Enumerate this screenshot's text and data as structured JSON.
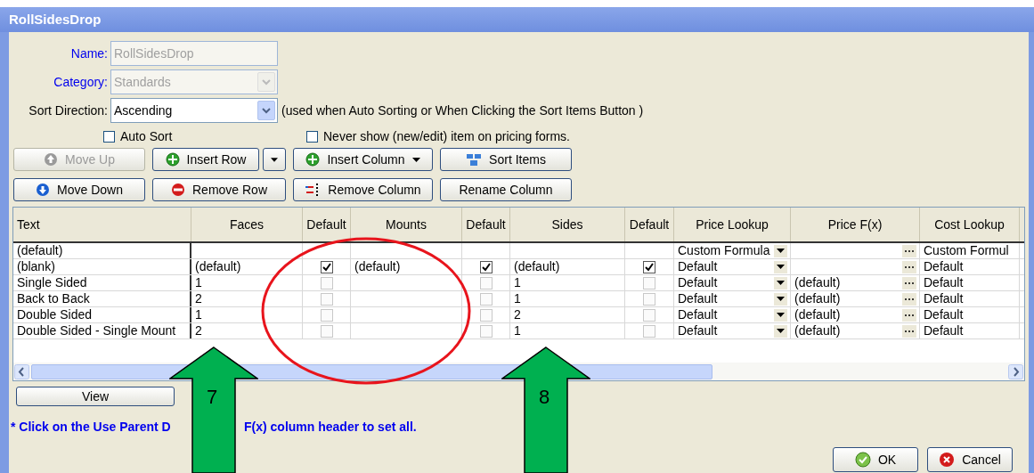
{
  "window": {
    "title": "RollSidesDrop"
  },
  "form": {
    "name": {
      "label": "Name:",
      "value": "RollSidesDrop",
      "disabled": true
    },
    "category": {
      "label": "Category:",
      "value": "Standards",
      "disabled": true
    },
    "sort_direction": {
      "label": "Sort Direction:",
      "value": "Ascending",
      "disabled": false,
      "hint": "(used when Auto Sorting or When Clicking the Sort Items Button )"
    },
    "checkboxes": [
      {
        "label": "Auto Sort",
        "checked": false
      },
      {
        "label": "Never show (new/edit) item on pricing forms.",
        "checked": false
      }
    ]
  },
  "toolbar": [
    [
      {
        "label": "Move Up",
        "disabled": true
      },
      {
        "label": "Insert Row",
        "split": true,
        "disabled": false
      },
      {
        "label": "Insert Column",
        "menu": true,
        "disabled": false
      },
      {
        "label": "Sort Items",
        "disabled": false
      }
    ],
    [
      {
        "label": "Move Down",
        "disabled": false
      },
      {
        "label": "Remove Row",
        "disabled": false
      },
      {
        "label": "Remove Column",
        "disabled": false
      },
      {
        "label": "Rename Column",
        "disabled": false
      }
    ]
  ],
  "table": {
    "columns": [
      {
        "label": "Text",
        "kind": "text"
      },
      {
        "label": "Faces",
        "kind": "text"
      },
      {
        "label": "Default",
        "kind": "check"
      },
      {
        "label": "Mounts",
        "kind": "text"
      },
      {
        "label": "Default",
        "kind": "check"
      },
      {
        "label": "Sides",
        "kind": "text"
      },
      {
        "label": "Default",
        "kind": "check"
      },
      {
        "label": "Price Lookup",
        "kind": "dropdown"
      },
      {
        "label": "Price F(x)",
        "kind": "formula"
      },
      {
        "label": "Cost Lookup",
        "kind": "text"
      }
    ],
    "rows": [
      [
        {
          "text": "(default)"
        },
        {},
        {},
        {},
        {},
        {},
        {},
        {
          "text": "Custom Formula"
        },
        {},
        {
          "text": "Custom Formul"
        }
      ],
      [
        {
          "text": "(blank)"
        },
        {
          "text": "(default)"
        },
        {
          "checked": true
        },
        {
          "text": "(default)"
        },
        {
          "checked": true
        },
        {
          "text": "(default)"
        },
        {
          "checked": true
        },
        {
          "text": "Default"
        },
        {},
        {
          "text": "Default"
        }
      ],
      [
        {
          "text": "Single Sided"
        },
        {
          "text": "1"
        },
        {
          "checked": false
        },
        {},
        {
          "checked": false
        },
        {
          "text": "1"
        },
        {
          "checked": false
        },
        {
          "text": "Default"
        },
        {
          "text": "(default)"
        },
        {
          "text": "Default"
        }
      ],
      [
        {
          "text": "Back to Back"
        },
        {
          "text": "2"
        },
        {
          "checked": false
        },
        {},
        {
          "checked": false
        },
        {
          "text": "1"
        },
        {
          "checked": false
        },
        {
          "text": "Default"
        },
        {
          "text": "(default)"
        },
        {
          "text": "Default"
        }
      ],
      [
        {
          "text": "Double Sided"
        },
        {
          "text": "1"
        },
        {
          "checked": false
        },
        {},
        {
          "checked": false
        },
        {
          "text": "2"
        },
        {
          "checked": false
        },
        {
          "text": "Default"
        },
        {
          "text": "(default)"
        },
        {
          "text": "Default"
        }
      ],
      [
        {
          "text": "Double Sided - Single Mount"
        },
        {
          "text": "2"
        },
        {
          "checked": false
        },
        {},
        {
          "checked": false
        },
        {
          "text": "1"
        },
        {
          "checked": false
        },
        {
          "text": "Default"
        },
        {
          "text": "(default)"
        },
        {
          "text": "Default"
        }
      ]
    ]
  },
  "view_button": "View",
  "note": [
    "* Click on the Use Parent D",
    "F(x) column header to set all."
  ],
  "buttons": [
    {
      "label": "OK"
    },
    {
      "label": "Cancel"
    }
  ],
  "annotations": [
    "7",
    "8"
  ]
}
